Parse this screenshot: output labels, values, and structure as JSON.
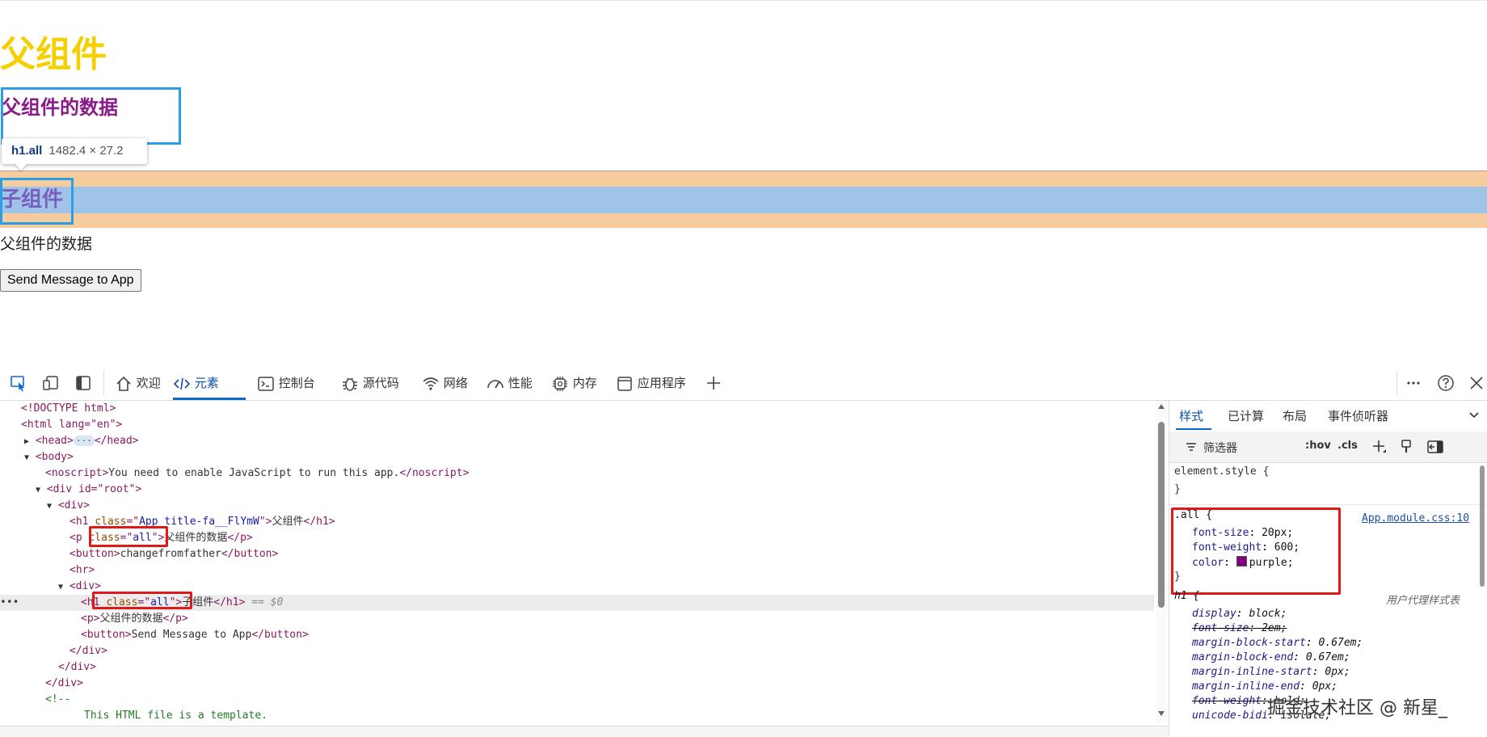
{
  "page": {
    "title": "父组件",
    "parent_data": "父组件的数据",
    "child_title": "子组件",
    "child_data": "父组件的数据",
    "send_button": "Send Message to App"
  },
  "tooltip": {
    "tag": "h1.all",
    "size": "1482.4 × 27.2"
  },
  "devtools": {
    "tabs": [
      "欢迎",
      "元素",
      "控制台",
      "源代码",
      "网络",
      "性能",
      "内存",
      "应用程序"
    ],
    "active_tab": "元素"
  },
  "dom_lines": [
    "<!DOCTYPE html>",
    "<html lang=\"en\">",
    "<head>",
    "</head>",
    "<body>",
    "<noscript>",
    "You need to enable JavaScript to run this app.",
    "</noscript>",
    "<div id=\"root\">",
    "<div>",
    "App_title-fa__FlYmW",
    "父组件",
    "all",
    "父组件的数据",
    "changefromfather",
    "<hr>",
    "<div>",
    "all",
    "子组件",
    "== $0",
    "父组件的数据",
    "Send Message to App",
    "</div>",
    "</div>",
    "</div>",
    "<!--",
    "This HTML file is a template."
  ],
  "styles_panel": {
    "tabs": [
      "样式",
      "已计算",
      "布局",
      "事件侦听器"
    ],
    "filter_label": "筛选器",
    "hov": ":hov",
    "cls": ".cls",
    "element_style": "element.style {",
    "close_brace": "}",
    "rule_selector": ".all {",
    "rule_source": "App.module.css:10",
    "rule_props": [
      {
        "name": "font-size",
        "value": "20px;"
      },
      {
        "name": "font-weight",
        "value": "600;"
      },
      {
        "name": "color",
        "value": "purple;"
      }
    ],
    "ua_selector": "h1 {",
    "ua_label": "用户代理样式表",
    "ua_props": [
      {
        "name": "display",
        "value": "block;"
      },
      {
        "name": "font-size",
        "value": "2em;"
      },
      {
        "name": "margin-block-start",
        "value": "0.67em;"
      },
      {
        "name": "margin-block-end",
        "value": "0.67em;"
      },
      {
        "name": "margin-inline-start",
        "value": "0px;"
      },
      {
        "name": "margin-inline-end",
        "value": "0px;"
      },
      {
        "name": "font-weight",
        "value": "bold;"
      },
      {
        "name": "unicode-bidi",
        "value": "isolate;"
      }
    ]
  },
  "watermark": "掘金技术社区 @ 新星_",
  "colors": {
    "accent": "#0b6ad0",
    "highlight_border": "#2a9ee6",
    "red_box": "#e01818",
    "margin": "#f6cc9e",
    "content": "#9fc4e8",
    "purple": "#800080"
  }
}
